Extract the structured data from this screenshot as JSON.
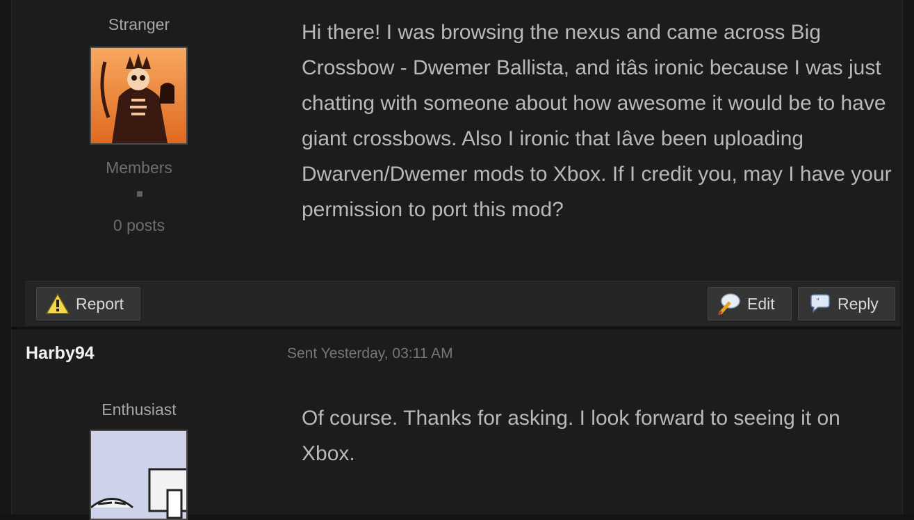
{
  "post1": {
    "rank": "Stranger",
    "group": "Members",
    "posts": "0 posts",
    "body": "Hi there! I was browsing the nexus and came across Big Crossbow - Dwemer Ballista, and itâs ironic because I was just chatting with someone about how awesome it would be to have giant crossbows. Also I ironic that Iâve been uploading Dwarven/Dwemer mods to Xbox. If I credit you, may I have your permission to port this mod?",
    "actions": {
      "report_label": "Report",
      "edit_label": "Edit",
      "reply_label": "Reply"
    }
  },
  "post2": {
    "author": "Harby94",
    "sent": "Sent Yesterday, 03:11 AM",
    "rank": "Enthusiast",
    "body": "Of course.  Thanks for asking.  I look forward to seeing it on Xbox."
  },
  "icons": {
    "report": "warning-icon",
    "edit": "edit-pen-icon",
    "reply": "speech-bubble-icon"
  },
  "colors": {
    "background": "#1c1c1c",
    "text": "#b9b9b9",
    "author": "#f2f2f2",
    "button": "#353535"
  }
}
